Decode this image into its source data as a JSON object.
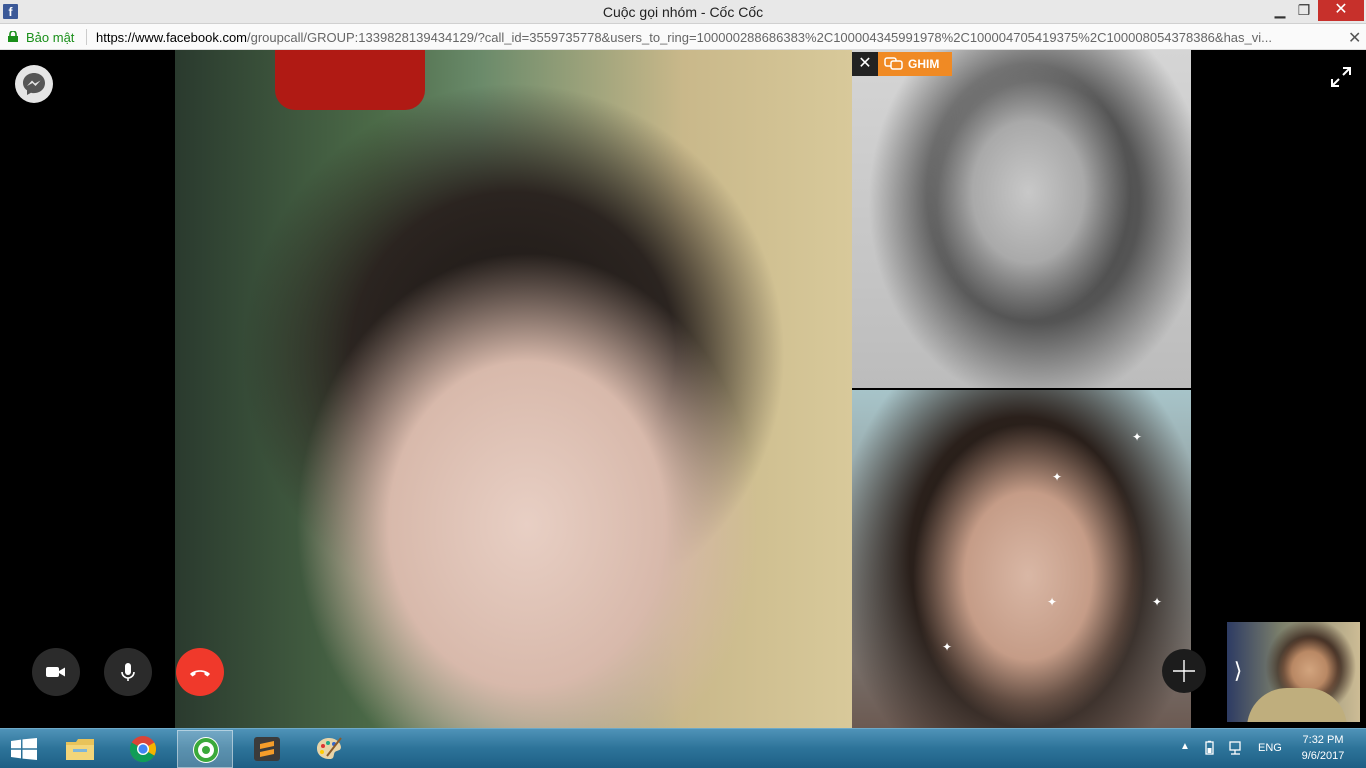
{
  "window": {
    "title": "Cuộc gọi nhóm - Cốc Cốc",
    "icon": "facebook-icon",
    "fb_letter": "f",
    "min_glyph": "▁",
    "max_glyph": "❐",
    "close_glyph": "✕"
  },
  "addressbar": {
    "secure_label": "Bảo mật",
    "url_host": "https://www.facebook.com",
    "url_rest": "/groupcall/GROUP:1339828139434129/?call_id=3559735778&users_to_ring=100000288686383%2C100004345991978%2C100004705419375%2C100008054378386&has_vi...",
    "close_glyph": "✕"
  },
  "call": {
    "pin_close_glyph": "✕",
    "pin_label": "GHIM",
    "chevron_glyph": "⟩",
    "sparkle_glyph": "✦"
  },
  "taskbar": {
    "apps": [
      "file-explorer",
      "chrome",
      "coc-coc",
      "sublime-text",
      "paint"
    ],
    "tray_up_glyph": "▲",
    "language": "ENG",
    "time": "7:32 PM",
    "date": "9/6/2017"
  },
  "colors": {
    "end_call": "#f0392b",
    "pin_badge": "#f08a24",
    "taskbar": "#2d7399",
    "secure_green": "#1a8f1a"
  }
}
